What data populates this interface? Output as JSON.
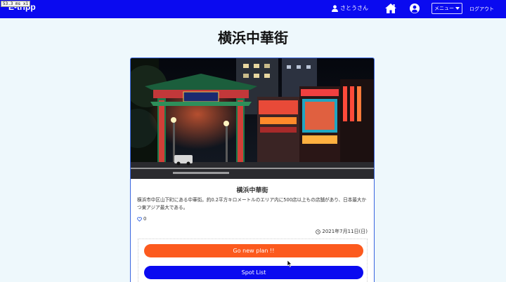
{
  "overlay": {
    "fps_text": "53.3 ms x1"
  },
  "navbar": {
    "brand": "E-tripp",
    "user_name": "さとうさん",
    "menu_label": "メニュー",
    "logout_label": "ログアウト"
  },
  "page": {
    "title": "横浜中華街"
  },
  "card": {
    "title": "横浜中華街",
    "description": "横浜市中区山下町にある中華街。約0.2平方キロメートルのエリア内に500店以上もの店舗があり、日本最大かつ東アジア最大である。",
    "likes": "0",
    "date": "2021年7月11日(日)"
  },
  "buttons": {
    "new_plan": "Go new plan !!",
    "spot_list": "Spot List"
  },
  "colors": {
    "navbar": "#0a0af0",
    "accent_orange": "#fc5a1e",
    "background": "#eef8fc"
  }
}
